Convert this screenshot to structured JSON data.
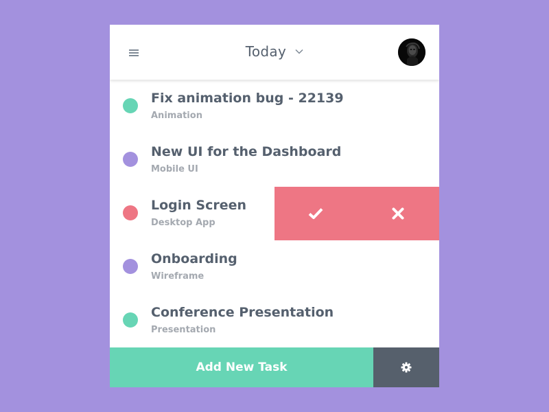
{
  "header": {
    "title": "Today",
    "menu_icon": "menu-icon",
    "dropdown_icon": "chevron-down-icon",
    "avatar_icon": "user-avatar"
  },
  "tasks": [
    {
      "title": "Fix animation bug - 22139",
      "category": "Animation",
      "color": "#67d5b5"
    },
    {
      "title": "New UI for the Dashboard",
      "category": "Mobile UI",
      "color": "#a391de"
    },
    {
      "title": "Login Screen",
      "category": "Desktop App",
      "color": "#ee7684"
    },
    {
      "title": "Onboarding",
      "category": "Wireframe",
      "color": "#a391de"
    },
    {
      "title": "Conference Presentation",
      "category": "Presentation",
      "color": "#67d5b5"
    }
  ],
  "swipe_actions": {
    "confirm_icon": "check-icon",
    "delete_icon": "close-icon",
    "color": "#ee7684"
  },
  "footer": {
    "add_label": "Add New Task",
    "settings_icon": "gear-icon"
  },
  "colors": {
    "background": "#a391de",
    "accent_green": "#67d5b5",
    "accent_purple": "#a391de",
    "accent_red": "#ee7684",
    "dark_slate": "#56606c",
    "text_primary": "#55606e",
    "text_secondary": "#a4a9b0"
  }
}
